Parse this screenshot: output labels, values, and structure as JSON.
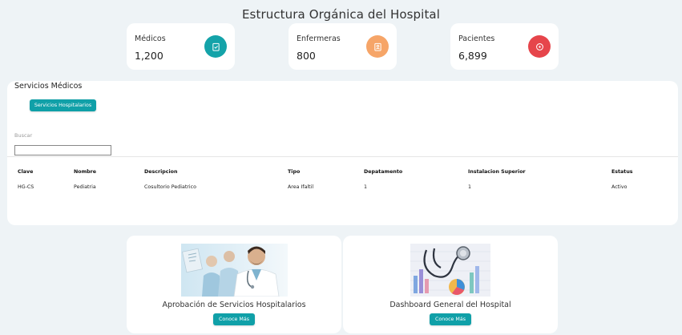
{
  "header": {
    "title": "Estructura Orgánica del Hospital"
  },
  "stats": [
    {
      "label": "Médicos",
      "value": "1,200",
      "color": "#14a3a9",
      "icon": "clipboard-check-icon"
    },
    {
      "label": "Enfermeras",
      "value": "800",
      "color": "#f6a568",
      "icon": "id-badge-icon"
    },
    {
      "label": "Pacientes",
      "value": "6,899",
      "color": "#e6454b",
      "icon": "target-icon"
    }
  ],
  "services": {
    "title": "Servicios Médicos",
    "tab_button": "Servicios Hospitalarios",
    "search_label": "Buscar",
    "search_value": "",
    "columns": [
      "Clave",
      "Nombre",
      "Descripcion",
      "Tipo",
      "Depatamento",
      "Instalacion Superior",
      "Estatus"
    ],
    "rows": [
      [
        "HG-CS",
        "Pediatria",
        "Cosultorio Pediatrico",
        "Area Ifaltil",
        "1",
        "1",
        "Activo"
      ]
    ]
  },
  "cards": [
    {
      "title": "Aprobación de Servicios Hospitalarios",
      "button": "Conoce Más",
      "image": "doctors-illustration"
    },
    {
      "title": "Dashboard General del Hospital",
      "button": "Conoce Más",
      "image": "stethoscope-charts-illustration"
    }
  ],
  "colors": {
    "accent": "#10a0a8",
    "background": "#eef3f6",
    "card": "#ffffff"
  }
}
